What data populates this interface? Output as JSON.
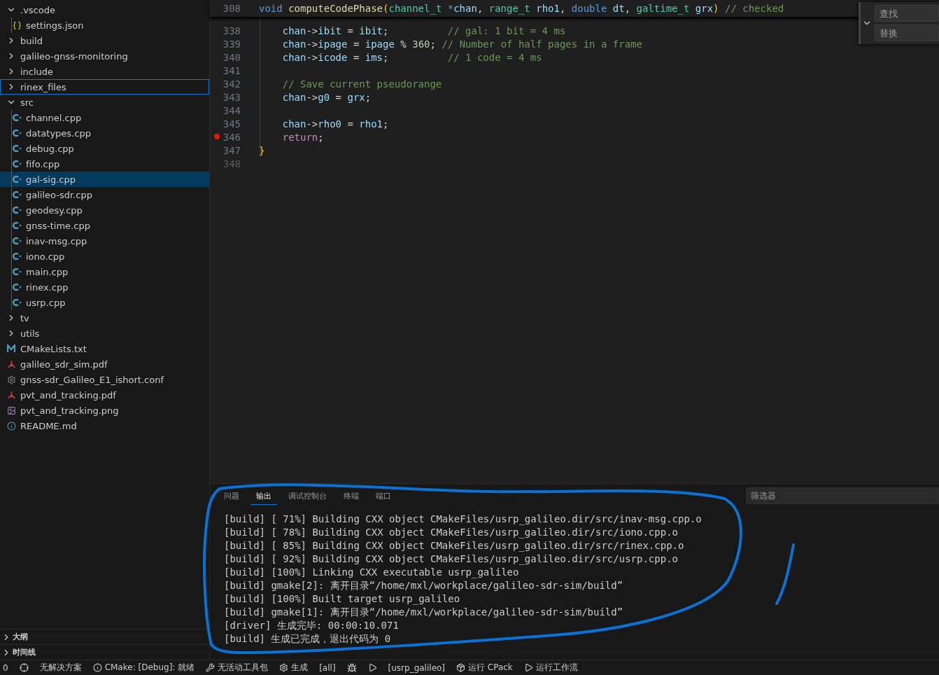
{
  "explorer": {
    "items": [
      {
        "label": ".vscode",
        "kind": "folder",
        "expanded": true,
        "selected": false,
        "focused": false,
        "children": [
          {
            "label": "settings.json",
            "kind": "json",
            "selected": false,
            "focused": false
          }
        ]
      },
      {
        "label": "build",
        "kind": "folder",
        "expanded": false,
        "selected": false,
        "focused": false
      },
      {
        "label": "galileo-gnss-monitoring",
        "kind": "folder",
        "expanded": false,
        "selected": false,
        "focused": false
      },
      {
        "label": "include",
        "kind": "folder",
        "expanded": false,
        "selected": false,
        "focused": false
      },
      {
        "label": "rinex_files",
        "kind": "folder",
        "expanded": false,
        "selected": false,
        "focused": true
      },
      {
        "label": "src",
        "kind": "folder",
        "expanded": true,
        "selected": false,
        "focused": false,
        "children": [
          {
            "label": "channel.cpp",
            "kind": "cpp",
            "selected": false,
            "focused": false
          },
          {
            "label": "datatypes.cpp",
            "kind": "cpp",
            "selected": false,
            "focused": false
          },
          {
            "label": "debug.cpp",
            "kind": "cpp",
            "selected": false,
            "focused": false
          },
          {
            "label": "fifo.cpp",
            "kind": "cpp",
            "selected": false,
            "focused": false
          },
          {
            "label": "gal-sig.cpp",
            "kind": "cpp",
            "selected": true,
            "focused": false
          },
          {
            "label": "galileo-sdr.cpp",
            "kind": "cpp",
            "selected": false,
            "focused": false
          },
          {
            "label": "geodesy.cpp",
            "kind": "cpp",
            "selected": false,
            "focused": false
          },
          {
            "label": "gnss-time.cpp",
            "kind": "cpp",
            "selected": false,
            "focused": false
          },
          {
            "label": "inav-msg.cpp",
            "kind": "cpp",
            "selected": false,
            "focused": false
          },
          {
            "label": "iono.cpp",
            "kind": "cpp",
            "selected": false,
            "focused": false
          },
          {
            "label": "main.cpp",
            "kind": "cpp",
            "selected": false,
            "focused": false
          },
          {
            "label": "rinex.cpp",
            "kind": "cpp",
            "selected": false,
            "focused": false
          },
          {
            "label": "usrp.cpp",
            "kind": "cpp",
            "selected": false,
            "focused": false
          }
        ]
      },
      {
        "label": "tv",
        "kind": "folder",
        "expanded": false,
        "selected": false,
        "focused": false
      },
      {
        "label": "utils",
        "kind": "folder",
        "expanded": false,
        "selected": false,
        "focused": false
      },
      {
        "label": "CMakeLists.txt",
        "kind": "cmake",
        "selected": false,
        "focused": false
      },
      {
        "label": "galileo_sdr_sim.pdf",
        "kind": "pdf",
        "selected": false,
        "focused": false
      },
      {
        "label": "gnss-sdr_Galileo_E1_ishort.conf",
        "kind": "conf",
        "selected": false,
        "focused": false
      },
      {
        "label": "pvt_and_tracking.pdf",
        "kind": "pdf",
        "selected": false,
        "focused": false
      },
      {
        "label": "pvt_and_tracking.png",
        "kind": "image",
        "selected": false,
        "focused": false
      },
      {
        "label": "README.md",
        "kind": "info",
        "selected": false,
        "focused": false
      }
    ]
  },
  "sections": [
    {
      "label": "大纲",
      "expanded": false
    },
    {
      "label": "时间线",
      "expanded": false
    }
  ],
  "editor": {
    "sticky": {
      "number": "308",
      "tokens": [
        {
          "kind": "keyword",
          "text": "void "
        },
        {
          "kind": "function",
          "text": "computeCodePhase"
        },
        {
          "kind": "bracket",
          "text": "("
        },
        {
          "kind": "type",
          "text": "channel_t "
        },
        {
          "kind": "keyword",
          "text": "*"
        },
        {
          "kind": "variable",
          "text": "chan"
        },
        {
          "kind": "plain",
          "text": ", "
        },
        {
          "kind": "type",
          "text": "range_t "
        },
        {
          "kind": "variable",
          "text": "rho1"
        },
        {
          "kind": "plain",
          "text": ", "
        },
        {
          "kind": "keyword",
          "text": "double "
        },
        {
          "kind": "variable",
          "text": "dt"
        },
        {
          "kind": "plain",
          "text": ", "
        },
        {
          "kind": "type",
          "text": "galtime_t "
        },
        {
          "kind": "variable",
          "text": "grx"
        },
        {
          "kind": "bracket",
          "text": ") "
        },
        {
          "kind": "comment",
          "text": "// checked"
        }
      ]
    },
    "lines": [
      {
        "number": "338",
        "breakpoint": false,
        "tokens": [
          {
            "kind": "variable",
            "text": "    chan"
          },
          {
            "kind": "plain",
            "text": "->"
          },
          {
            "kind": "variable",
            "text": "ibit"
          },
          {
            "kind": "plain",
            "text": " = "
          },
          {
            "kind": "variable",
            "text": "ibit"
          },
          {
            "kind": "plain",
            "text": ";          "
          },
          {
            "kind": "comment",
            "text": "// gal: 1 bit = 4 ms"
          }
        ]
      },
      {
        "number": "339",
        "breakpoint": false,
        "tokens": [
          {
            "kind": "variable",
            "text": "    chan"
          },
          {
            "kind": "plain",
            "text": "->"
          },
          {
            "kind": "variable",
            "text": "ipage"
          },
          {
            "kind": "plain",
            "text": " = "
          },
          {
            "kind": "variable",
            "text": "ipage"
          },
          {
            "kind": "plain",
            "text": " % "
          },
          {
            "kind": "number",
            "text": "360"
          },
          {
            "kind": "plain",
            "text": "; "
          },
          {
            "kind": "comment",
            "text": "// Number of half pages in a frame"
          }
        ]
      },
      {
        "number": "340",
        "breakpoint": false,
        "tokens": [
          {
            "kind": "variable",
            "text": "    chan"
          },
          {
            "kind": "plain",
            "text": "->"
          },
          {
            "kind": "variable",
            "text": "icode"
          },
          {
            "kind": "plain",
            "text": " = "
          },
          {
            "kind": "variable",
            "text": "ims"
          },
          {
            "kind": "plain",
            "text": ";          "
          },
          {
            "kind": "comment",
            "text": "// 1 code = 4 ms"
          }
        ]
      },
      {
        "number": "341",
        "breakpoint": false
      },
      {
        "number": "342",
        "breakpoint": false,
        "tokens": [
          {
            "kind": "comment",
            "text": "    // Save current pseudorange"
          }
        ]
      },
      {
        "number": "343",
        "breakpoint": false,
        "tokens": [
          {
            "kind": "variable",
            "text": "    chan"
          },
          {
            "kind": "plain",
            "text": "->"
          },
          {
            "kind": "variable",
            "text": "g0"
          },
          {
            "kind": "plain",
            "text": " = "
          },
          {
            "kind": "variable",
            "text": "grx"
          },
          {
            "kind": "plain",
            "text": ";"
          }
        ]
      },
      {
        "number": "344",
        "breakpoint": false
      },
      {
        "number": "345",
        "breakpoint": false,
        "tokens": [
          {
            "kind": "variable",
            "text": "    chan"
          },
          {
            "kind": "plain",
            "text": "->"
          },
          {
            "kind": "variable",
            "text": "rho0"
          },
          {
            "kind": "plain",
            "text": " = "
          },
          {
            "kind": "variable",
            "text": "rho1"
          },
          {
            "kind": "plain",
            "text": ";"
          }
        ]
      },
      {
        "number": "346",
        "breakpoint": true,
        "tokens": [
          {
            "kind": "control",
            "text": "    return"
          },
          {
            "kind": "plain",
            "text": ";"
          }
        ]
      },
      {
        "number": "347",
        "breakpoint": false,
        "tokens": [
          {
            "kind": "bracket",
            "text": "}"
          }
        ]
      },
      {
        "number": "348",
        "breakpoint": false,
        "dim": true
      }
    ]
  },
  "find": {
    "expanded": true,
    "find_placeholder": "查找",
    "replace_placeholder": "替换"
  },
  "panel": {
    "tabs": [
      {
        "label": "问题",
        "selected": false
      },
      {
        "label": "输出",
        "selected": true
      },
      {
        "label": "调试控制台",
        "selected": false
      },
      {
        "label": "终端",
        "selected": false
      },
      {
        "label": "端口",
        "selected": false
      }
    ],
    "filter_placeholder": "筛选器",
    "output": [
      "[build] [ 71%] Building CXX object CMakeFiles/usrp_galileo.dir/src/inav-msg.cpp.o",
      "[build] [ 78%] Building CXX object CMakeFiles/usrp_galileo.dir/src/iono.cpp.o",
      "[build] [ 85%] Building CXX object CMakeFiles/usrp_galileo.dir/src/rinex.cpp.o",
      "[build] [ 92%] Building CXX object CMakeFiles/usrp_galileo.dir/src/usrp.cpp.o",
      "[build] [100%] Linking CXX executable usrp_galileo",
      "[build] gmake[2]: 离开目录“/home/mxl/workplace/galileo-sdr-sim/build”",
      "[build] [100%] Built target usrp_galileo",
      "[build] gmake[1]: 离开目录“/home/mxl/workplace/galileo-sdr-sim/build”",
      "[driver] 生成完毕: 00:00:10.071",
      "[build] 生成已完成，退出代码为 0"
    ]
  },
  "status_bar": [
    {
      "text": "0"
    },
    {
      "kind": "target"
    },
    {
      "text": "无解决方案"
    },
    {
      "kind": "info",
      "text": "CMake: [Debug]: 就绪"
    },
    {
      "kind": "tools",
      "text": "无活动工具包"
    },
    {
      "kind": "gear",
      "text": "生成"
    },
    {
      "text": "[all]"
    },
    {
      "kind": "bug"
    },
    {
      "kind": "play"
    },
    {
      "text": "[usrp_galileo]"
    },
    {
      "kind": "box",
      "text": "运行 CPack"
    },
    {
      "kind": "play",
      "text": "运行工作流"
    }
  ]
}
